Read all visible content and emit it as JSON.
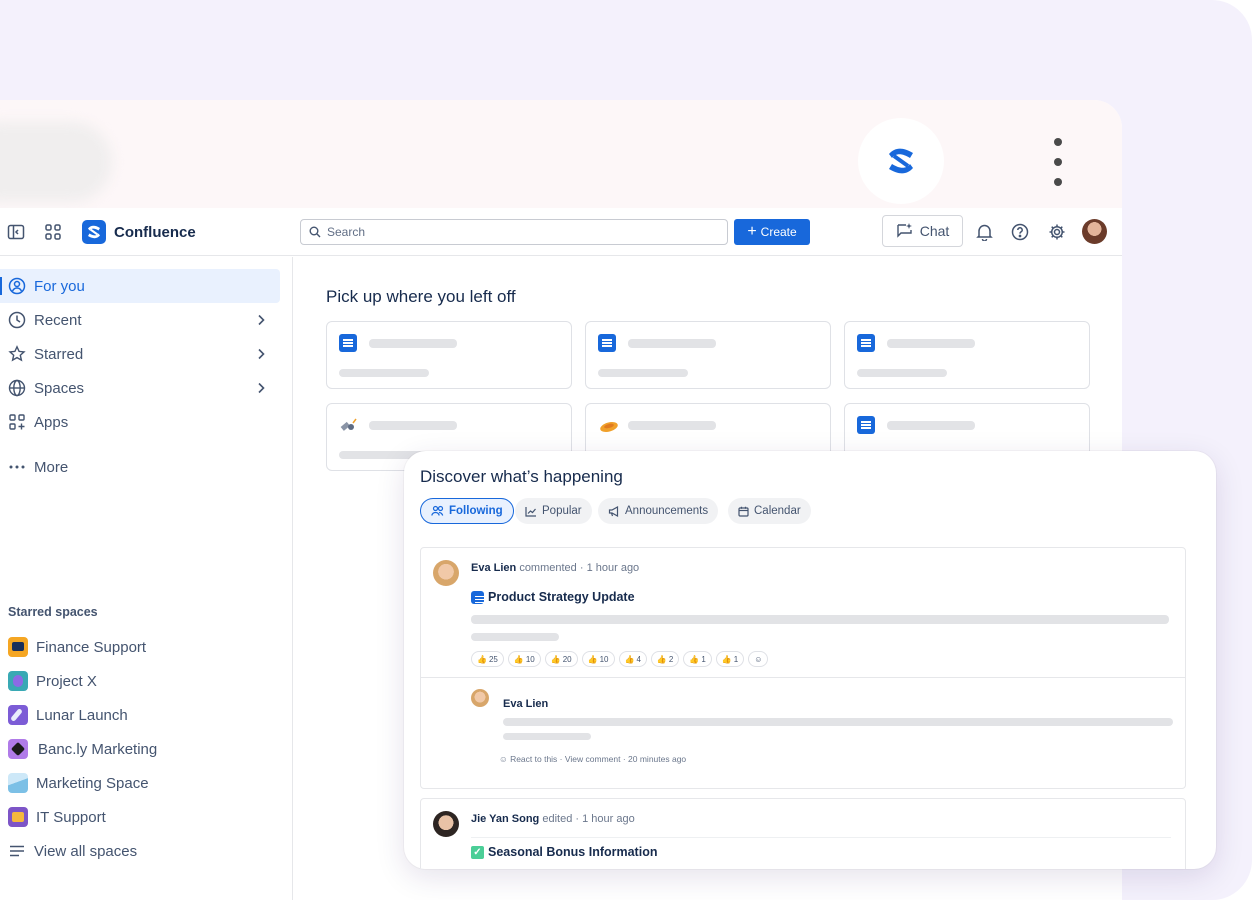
{
  "header": {
    "app_name": "Confluence",
    "search_placeholder": "Search",
    "create_label": "Create",
    "chat_label": "Chat"
  },
  "sidebar": {
    "items": [
      {
        "label": "For you"
      },
      {
        "label": "Recent"
      },
      {
        "label": "Starred"
      },
      {
        "label": "Spaces"
      },
      {
        "label": "Apps"
      },
      {
        "label": "More"
      }
    ],
    "starred_title": "Starred spaces",
    "spaces": [
      {
        "label": "Finance Support",
        "color": "#f5a623"
      },
      {
        "label": "Project X",
        "color": "#39a9b4"
      },
      {
        "label": "Lunar Launch",
        "color": "#7c5cd6"
      },
      {
        "label": "Banc.ly Marketing",
        "color": "#b07be8"
      },
      {
        "label": "Marketing Space",
        "color": "#7cc0e6"
      },
      {
        "label": "IT Support",
        "color": "#7d55c7"
      }
    ],
    "view_all": "View all spaces"
  },
  "main": {
    "title": "Pick up where you left off"
  },
  "discover": {
    "title": "Discover what’s happening",
    "tabs": [
      {
        "label": "Following"
      },
      {
        "label": "Popular"
      },
      {
        "label": "Announcements"
      },
      {
        "label": "Calendar"
      }
    ],
    "post1": {
      "author": "Eva Lien",
      "action": "commented",
      "time": "1 hour ago",
      "title": "Product Strategy Update",
      "reactions": [
        "25",
        "10",
        "20",
        "10",
        "4",
        "2",
        "1",
        "1"
      ],
      "comment_author": "Eva Lien",
      "react_to_this": "React to this",
      "view_comment": "View comment",
      "comment_time": "20 minutes ago"
    },
    "post2": {
      "author": "Jie Yan Song",
      "action": "edited",
      "time": "1 hour ago",
      "title": "Seasonal Bonus Information"
    }
  },
  "colors": {
    "brand": "#1868db",
    "background": "#f4f1fc"
  }
}
